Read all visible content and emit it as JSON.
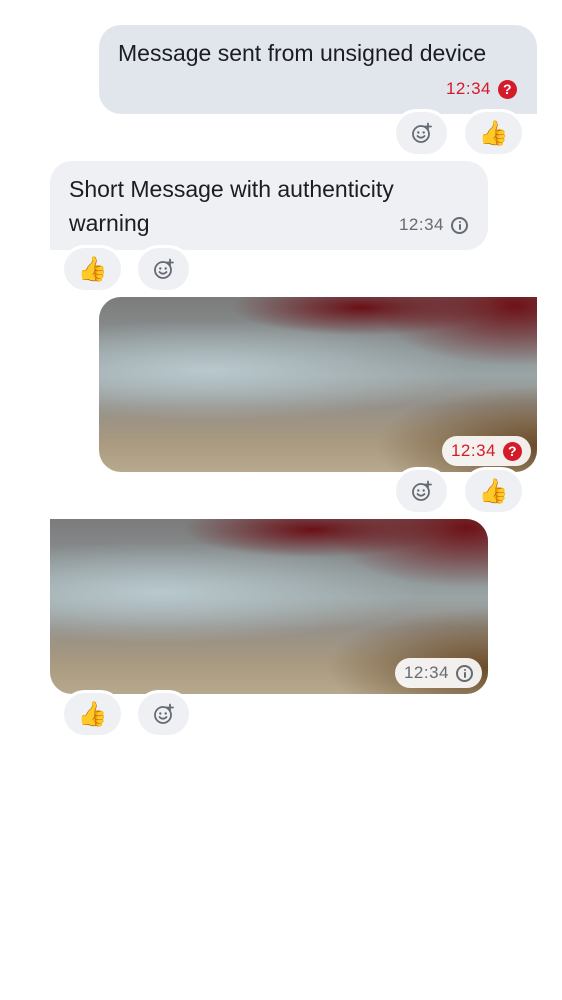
{
  "messages": [
    {
      "direction": "outgoing",
      "text": "Message sent from unsigned device",
      "timestamp": "12:34",
      "status_icon": "help-icon",
      "status_color": "#d41b2a",
      "reactions": {
        "add_reaction_icon": "add-reaction-icon",
        "thumbs_up": "👍"
      }
    },
    {
      "direction": "incoming",
      "text": "Short Message with authenticity warning",
      "timestamp": "12:34",
      "status_icon": "info-icon",
      "reactions": {
        "add_reaction_icon": "add-reaction-icon",
        "thumbs_up": "👍"
      }
    },
    {
      "direction": "outgoing",
      "type": "image",
      "timestamp": "12:34",
      "status_icon": "help-icon",
      "status_color": "#d41b2a",
      "reactions": {
        "add_reaction_icon": "add-reaction-icon",
        "thumbs_up": "👍"
      }
    },
    {
      "direction": "incoming",
      "type": "image",
      "timestamp": "12:34",
      "status_icon": "info-icon",
      "reactions": {
        "add_reaction_icon": "add-reaction-icon",
        "thumbs_up": "👍"
      }
    }
  ],
  "colors": {
    "outgoing_bubble": "#e1e6ec",
    "incoming_bubble": "#eef0f3",
    "warning_red": "#d41b2a",
    "timestamp_grey": "#656b75"
  }
}
